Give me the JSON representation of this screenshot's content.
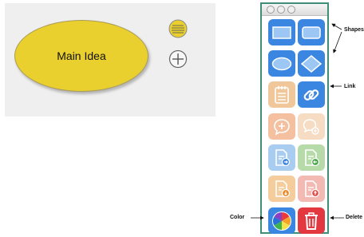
{
  "canvas": {
    "node": {
      "label": "Main Idea",
      "fill": "#ead02e"
    }
  },
  "palette": {
    "window_controls": [
      "close",
      "minimize",
      "zoom"
    ],
    "buttons": [
      {
        "name": "rectangle-shape-button",
        "icon": "rectangle-icon"
      },
      {
        "name": "rounded-rectangle-shape-button",
        "icon": "rounded-rectangle-icon"
      },
      {
        "name": "ellipse-shape-button",
        "icon": "ellipse-icon"
      },
      {
        "name": "diamond-shape-button",
        "icon": "diamond-icon"
      },
      {
        "name": "note-button",
        "icon": "notepad-icon"
      },
      {
        "name": "link-button",
        "icon": "chain-link-icon"
      },
      {
        "name": "add-comment-button",
        "icon": "comment-add-icon"
      },
      {
        "name": "comment-search-button",
        "icon": "comment-search-icon"
      },
      {
        "name": "attach-document-button",
        "icon": "document-attach-icon"
      },
      {
        "name": "export-document-button",
        "icon": "document-export-icon"
      },
      {
        "name": "download-document-button",
        "icon": "document-download-icon"
      },
      {
        "name": "upload-document-button",
        "icon": "document-upload-icon"
      },
      {
        "name": "color-button",
        "icon": "color-wheel-icon"
      },
      {
        "name": "delete-button",
        "icon": "trash-icon"
      }
    ]
  },
  "annotations": {
    "shapes": "Shapes",
    "link": "Link",
    "color": "Color",
    "delete": "Delete"
  },
  "colors": {
    "accent_blue": "#3a86e0",
    "delete_red": "#e3383f",
    "palette_border": "#3f8f78"
  }
}
